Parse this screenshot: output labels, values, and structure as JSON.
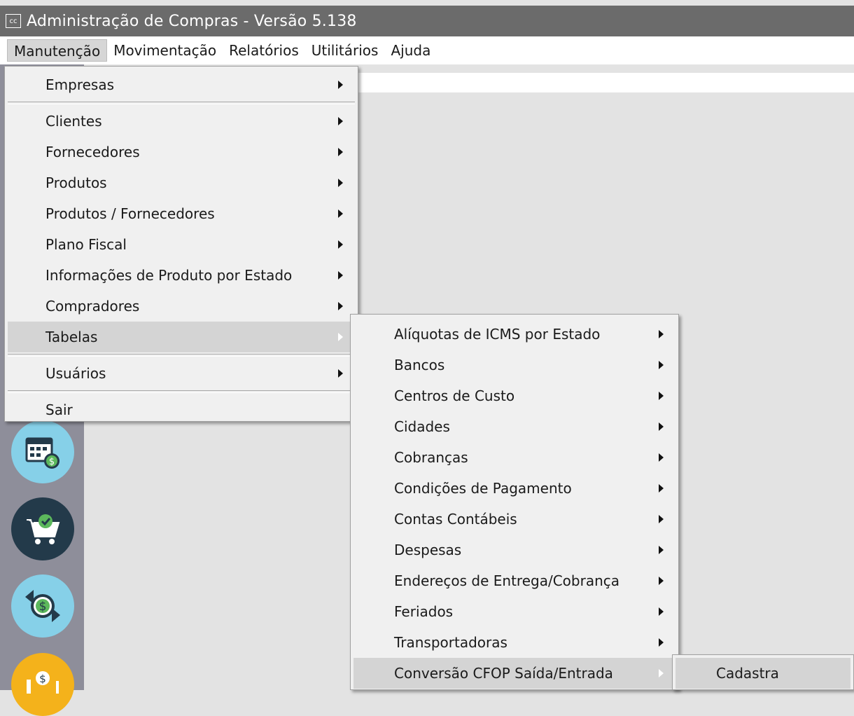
{
  "window": {
    "icon_text": "cc",
    "title": "Administração de Compras - Versão 5.138"
  },
  "menubar": {
    "items": [
      "Manutenção",
      "Movimentação",
      "Relatórios",
      "Utilitários",
      "Ajuda"
    ]
  },
  "menu_manutencao": {
    "items": [
      "Empresas",
      "Clientes",
      "Fornecedores",
      "Produtos",
      "Produtos / Fornecedores",
      "Plano Fiscal",
      "Informações de Produto por Estado",
      "Compradores",
      "Tabelas",
      "Usuários",
      "Sair"
    ]
  },
  "menu_tabelas": {
    "items": [
      "Alíquotas de ICMS por Estado",
      "Bancos",
      "Centros de Custo",
      "Cidades",
      "Cobranças",
      "Condições de Pagamento",
      "Contas Contábeis",
      "Despesas",
      "Endereços de Entrega/Cobrança",
      "Feriados",
      "Transportadoras",
      "Conversão CFOP Saída/Entrada"
    ]
  },
  "menu_conversao": {
    "items": [
      "Cadastra"
    ]
  },
  "toolbar": {
    "icons": [
      "calendar-money-icon",
      "cart-check-icon",
      "money-exchange-icon",
      "money-hand-icon"
    ]
  }
}
